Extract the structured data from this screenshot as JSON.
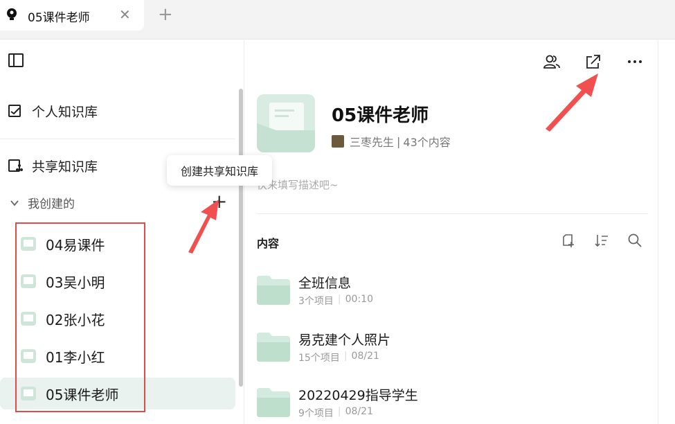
{
  "tabbar": {
    "tab_title": "05课件老师",
    "close_symbol": "✕",
    "add_symbol": "+"
  },
  "sidebar": {
    "personal": "个人知识库",
    "shared": "共享知识库",
    "group_label": "我创建的",
    "add_symbol": "+",
    "tooltip": "创建共享知识库",
    "items": [
      {
        "label": "04易课件"
      },
      {
        "label": "03吴小明"
      },
      {
        "label": "02张小花"
      },
      {
        "label": "01李小红"
      },
      {
        "label": "05课件老师"
      }
    ]
  },
  "main": {
    "title": "05课件老师",
    "owner": "三枣先生",
    "owner_sep": "|",
    "count": "43个内容",
    "desc_placeholder": "快来填写描述吧~",
    "content_label": "内容",
    "rows": [
      {
        "name": "全班信息",
        "items": "3个项目",
        "time": "00:10"
      },
      {
        "name": "易克建个人照片",
        "items": "15个项目",
        "time": "08/21"
      },
      {
        "name": "20220429指导学生",
        "items": "9个项目",
        "time": "08/21"
      }
    ]
  },
  "colors": {
    "accent_green": "#d8ece2",
    "active_bg": "#e9f2ee",
    "annotation_red": "#e64848"
  }
}
